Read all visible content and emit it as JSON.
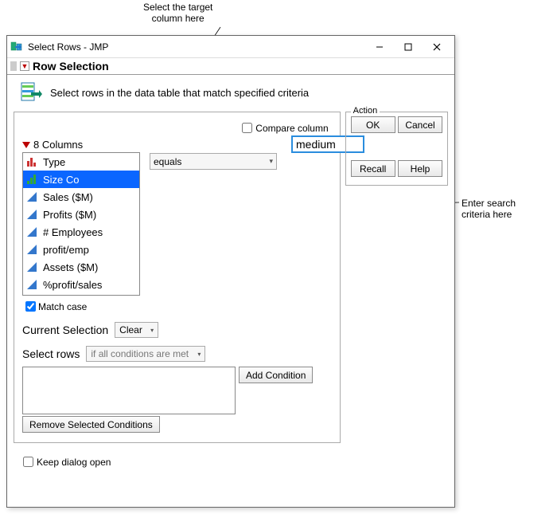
{
  "annotations": {
    "top": "Select the target\ncolumn here",
    "right": "Enter search\ncriteria here"
  },
  "window": {
    "title": "Select Rows - JMP"
  },
  "section": {
    "title": "Row Selection",
    "description": "Select rows in the data table that match specified criteria"
  },
  "columns": {
    "header": "8 Columns",
    "items": [
      {
        "label": "Type",
        "icon": "nominal"
      },
      {
        "label": "Size Co",
        "icon": "ordinal",
        "selected": true
      },
      {
        "label": "Sales ($M)",
        "icon": "continuous"
      },
      {
        "label": "Profits ($M)",
        "icon": "continuous"
      },
      {
        "label": "# Employees",
        "icon": "continuous"
      },
      {
        "label": "profit/emp",
        "icon": "continuous"
      },
      {
        "label": "Assets ($M)",
        "icon": "continuous"
      },
      {
        "label": "%profit/sales",
        "icon": "continuous"
      }
    ]
  },
  "operator": {
    "value": "equals"
  },
  "compare_column": {
    "label": "Compare column",
    "checked": false
  },
  "search": {
    "value": "medium"
  },
  "match_case": {
    "label": "Match case",
    "checked": true
  },
  "current_selection": {
    "label": "Current Selection",
    "value": "Clear"
  },
  "select_rows": {
    "label": "Select rows",
    "value": "if all conditions are met"
  },
  "add_condition": {
    "label": "Add Condition"
  },
  "remove_condition": {
    "label": "Remove Selected Conditions"
  },
  "keep_open": {
    "label": "Keep dialog open",
    "checked": false
  },
  "action": {
    "legend": "Action",
    "ok": "OK",
    "cancel": "Cancel",
    "recall": "Recall",
    "help": "Help"
  }
}
